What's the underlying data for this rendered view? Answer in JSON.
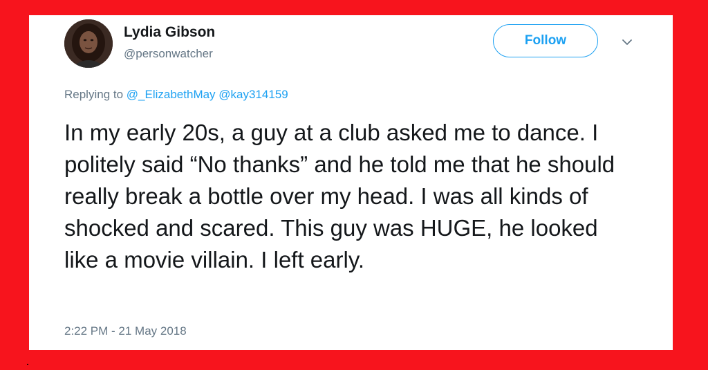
{
  "tweet": {
    "author": {
      "name": "Lydia Gibson",
      "handle": "@personwatcher"
    },
    "follow_label": "Follow",
    "reply": {
      "prefix": "Replying to",
      "mentions": [
        "@_ElizabethMay",
        "@kay314159"
      ]
    },
    "text": "In my early 20s, a guy at a club asked me to dance. I politely said “No thanks” and he told me that he should really break a bottle over my head. I was all kinds of shocked and scared. This guy was HUGE, he looked like a movie villain. I left early.",
    "timestamp": "2:22 PM - 21 May 2018"
  },
  "icons": {
    "more": "chevron-down-icon"
  },
  "colors": {
    "background": "#f7141d",
    "card": "#ffffff",
    "accent": "#1da1f2",
    "text_primary": "#14171a",
    "text_secondary": "#657786"
  }
}
